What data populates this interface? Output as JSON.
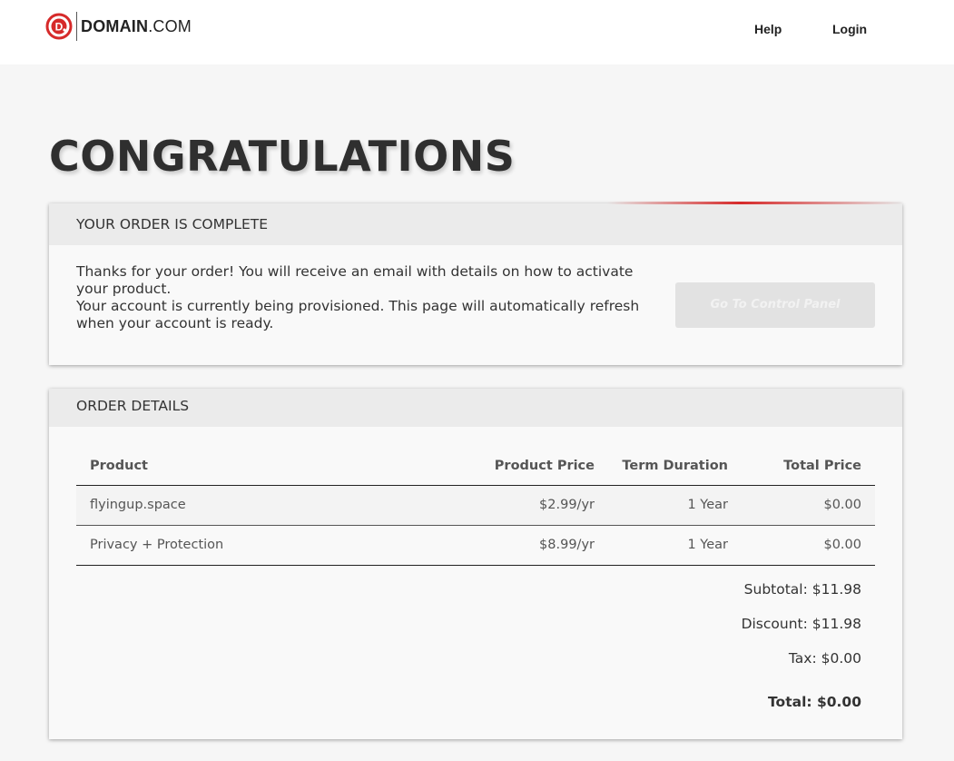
{
  "header": {
    "logo_text_bold": "DOMAIN",
    "logo_text_rest": ".COM",
    "logo_glyph": "D",
    "nav": {
      "help": "Help",
      "login": "Login"
    }
  },
  "page_title": "CONGRATULATIONS",
  "order_complete": {
    "heading": "YOUR ORDER IS COMPLETE",
    "message_line1": "Thanks for your order! You will receive an email with details on how to activate your product.",
    "message_line2": "Your account is currently being provisioned. This page will automatically refresh when your account is ready.",
    "button_label": "Go To Control Panel"
  },
  "order_details": {
    "heading": "ORDER DETAILS",
    "columns": [
      "Product",
      "Product Price",
      "Term Duration",
      "Total Price"
    ],
    "rows": [
      {
        "product": "flyingup.space",
        "price": "$2.99/yr",
        "term": "1 Year",
        "total": "$0.00"
      },
      {
        "product": "Privacy + Protection",
        "price": "$8.99/yr",
        "term": "1 Year",
        "total": "$0.00"
      }
    ],
    "subtotal": "Subtotal: $11.98",
    "discount": "Discount: $11.98",
    "tax": "Tax: $0.00",
    "total": "Total: $0.00"
  },
  "colors": {
    "brand_red": "#d62a2a",
    "accent_line": "#d62a2a"
  }
}
